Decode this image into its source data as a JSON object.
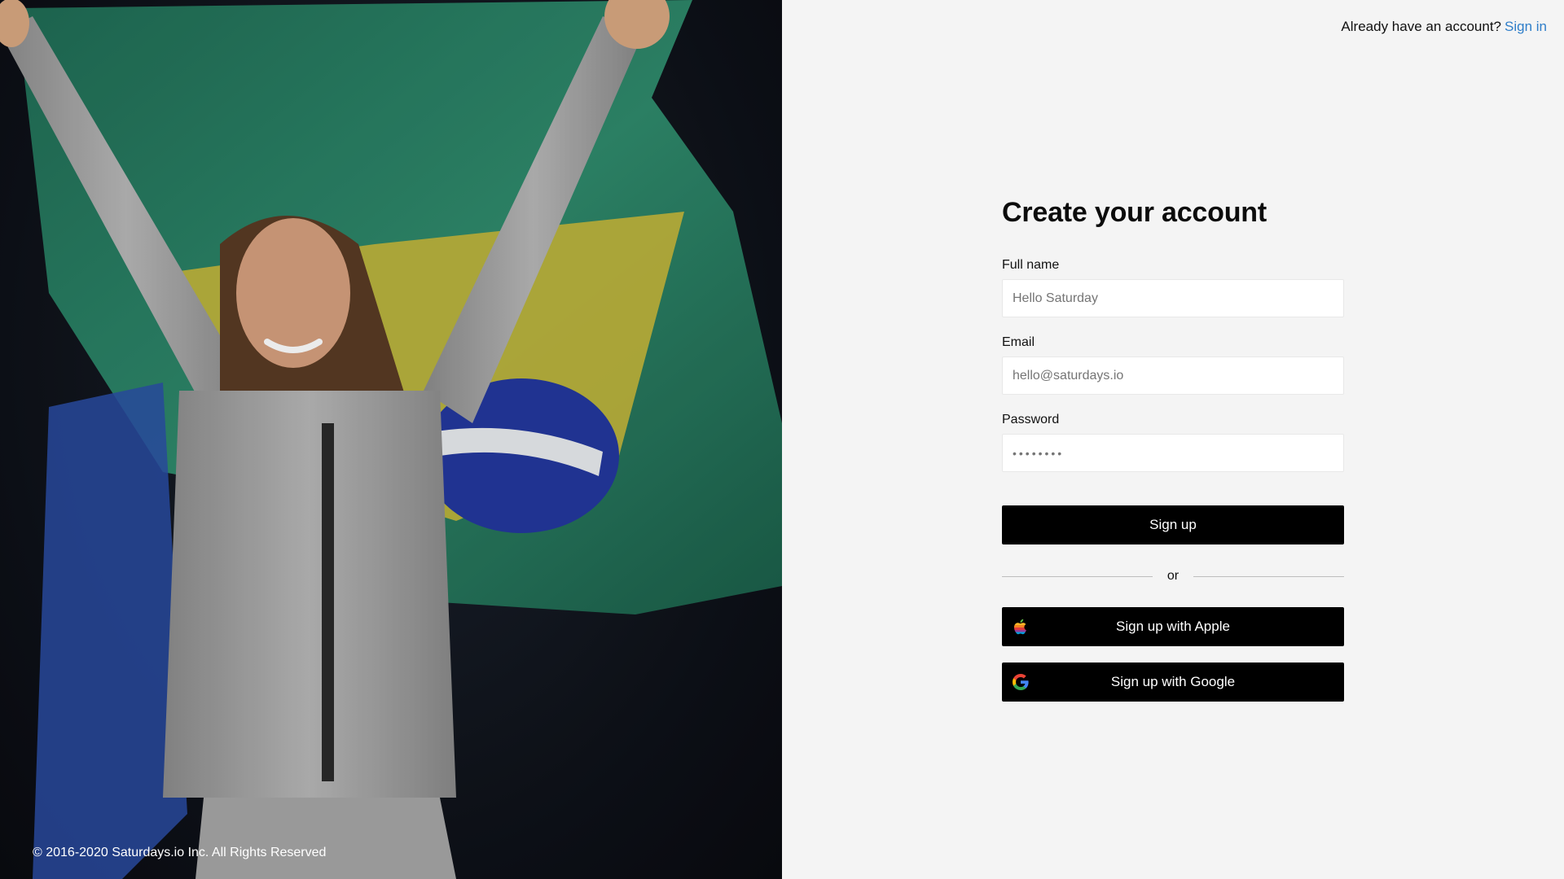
{
  "hero": {
    "copyright": "© 2016-2020 Saturdays.io Inc. All Rights Reserved"
  },
  "header": {
    "prompt": "Already have an account?",
    "signin_link": "Sign in"
  },
  "form": {
    "title": "Create your account",
    "fullname_label": "Full name",
    "fullname_placeholder": "Hello Saturday",
    "email_label": "Email",
    "email_placeholder": "hello@saturdays.io",
    "password_label": "Password",
    "password_placeholder": "••••••••",
    "signup_button": "Sign up",
    "divider_text": "or",
    "apple_button": "Sign up with Apple",
    "google_button": "Sign up with Google"
  },
  "colors": {
    "link": "#2f7ec9",
    "button_bg": "#000000",
    "panel_bg": "#f4f4f4"
  },
  "icons": [
    "apple-icon",
    "google-icon"
  ]
}
